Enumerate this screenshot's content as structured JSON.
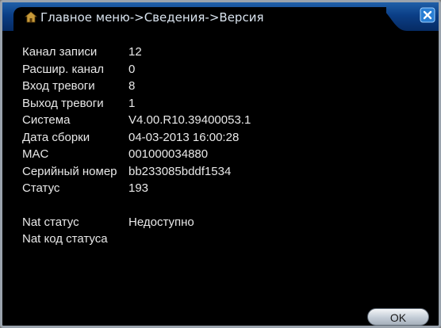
{
  "window": {
    "title": "Главное меню->Сведения->Версия"
  },
  "info_rows": [
    {
      "label": "Канал записи",
      "value": "12"
    },
    {
      "label": "Расшир. канал",
      "value": "0"
    },
    {
      "label": "Вход тревоги",
      "value": "8"
    },
    {
      "label": "Выход тревоги",
      "value": "1"
    },
    {
      "label": "Система",
      "value": "V4.00.R10.39400053.1"
    },
    {
      "label": "Дата сборки",
      "value": "04-03-2013 16:00:28"
    },
    {
      "label": "MAC",
      "value": "001000034880"
    },
    {
      "label": "Серийный номер",
      "value": "bb233085bddf1534"
    },
    {
      "label": "Статус",
      "value": "193"
    }
  ],
  "nat": {
    "status_label": "Nat статус",
    "status_value": "Недоступно",
    "code_label": "Nat код статуса",
    "code_value": ""
  },
  "buttons": {
    "ok_label": "OK"
  },
  "colors": {
    "title_bar": "#0b3e86",
    "background": "#000000",
    "text": "#e8e8e8",
    "close_button": "#2a7fd4"
  },
  "icons": {
    "home": "home-menu-icon",
    "close": "close-icon"
  }
}
